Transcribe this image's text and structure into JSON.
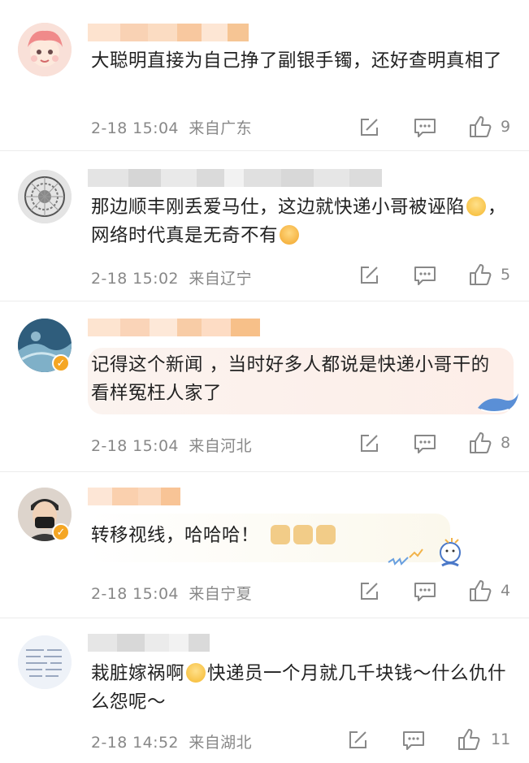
{
  "comments": [
    {
      "text": "大聪明直接为自己挣了副银手镯，还好查明真相了",
      "date": "2-18 15:04",
      "location": "来自广东",
      "likes": "9"
    },
    {
      "text_a": "那边顺丰刚丢爱马仕，这边就快递小哥被诬陷",
      "text_b": "，网络时代真是无奇不有",
      "date": "2-18 15:02",
      "location": "来自辽宁",
      "likes": "5"
    },
    {
      "text": "记得这个新闻 ，当时好多人都说是快递小哥干的  看样冤枉人家了",
      "date": "2-18 15:04",
      "location": "来自河北",
      "likes": "8"
    },
    {
      "text": "转移视线，哈哈哈！",
      "date": "2-18 15:04",
      "location": "来自宁夏",
      "likes": "4"
    },
    {
      "text_a": "栽脏嫁祸啊",
      "text_b": "快递员一个月就几千块钱～什么仇什么怨呢～",
      "date": "2-18 14:52",
      "location": "来自湖北",
      "likes": "11"
    }
  ],
  "icons": {
    "forward": "share-edit-icon",
    "reply": "comment-icon",
    "like": "thumbs-up-icon",
    "verified": "verified-badge-icon"
  },
  "colors": {
    "text": "#222222",
    "meta": "#888888",
    "badge": "#f5a623",
    "separator": "#ececec"
  }
}
